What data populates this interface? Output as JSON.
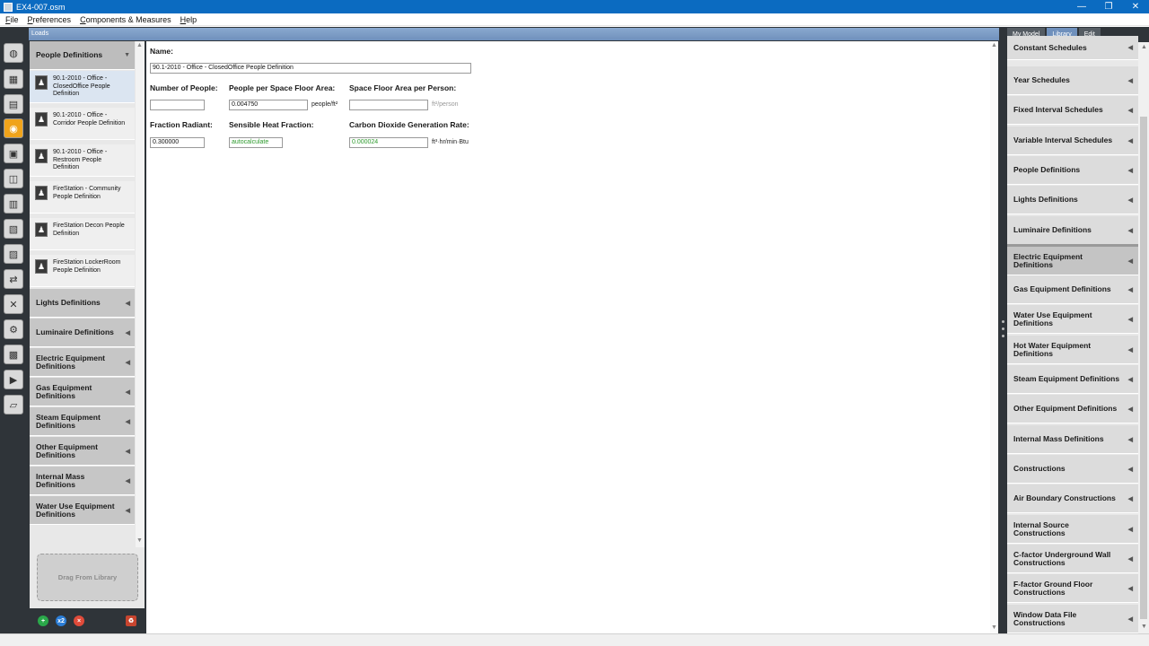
{
  "window": {
    "title": "EX4-007.osm",
    "minimize": "—",
    "maximize": "❐",
    "close": "✕"
  },
  "menu": {
    "items": [
      {
        "first": "F",
        "rest": "ile"
      },
      {
        "first": "P",
        "rest": "references"
      },
      {
        "first": "C",
        "rest": "omponents & Measures"
      },
      {
        "first": "H",
        "rest": "elp"
      }
    ]
  },
  "loads_header": "Loads",
  "left_panel": {
    "open_category": "People Definitions",
    "items": [
      "90.1-2010 - Office - ClosedOffice People Definition",
      "90.1-2010 - Office - Corridor People Definition",
      "90.1-2010 - Office - Restroom People Definition",
      "FireStation - Community People Definition",
      "FireStation Decon People Definition",
      "FireStation LockerRoom People Definition"
    ],
    "categories": [
      "Lights Definitions",
      "Luminaire Definitions",
      "Electric Equipment Definitions",
      "Gas Equipment Definitions",
      "Steam Equipment Definitions",
      "Other Equipment Definitions",
      "Internal Mass Definitions",
      "Water Use Equipment Definitions"
    ],
    "drop_zone": "Drag From Library"
  },
  "form": {
    "name_label": "Name:",
    "name_value": "90.1-2010 - Office - ClosedOffice People Definition",
    "number_people_label": "Number of People:",
    "number_people_value": "",
    "ppl_per_area_label": "People per Space Floor Area:",
    "ppl_per_area_value": "0.004750",
    "ppl_per_area_unit": "people/ft²",
    "area_per_person_label": "Space Floor Area per Person:",
    "area_per_person_value": "",
    "area_per_person_unit": "ft²/person",
    "fraction_radiant_label": "Fraction Radiant:",
    "fraction_radiant_value": "0.300000",
    "sensible_label": "Sensible Heat Fraction:",
    "sensible_value": "autocalculate",
    "co2_label": "Carbon Dioxide Generation Rate:",
    "co2_value": "0.000024",
    "co2_unit": "ft³·hr/min·Btu"
  },
  "right_tabs": [
    "My Model",
    "Library",
    "Edit"
  ],
  "right_panel": {
    "items": [
      "Constant Schedules",
      "Year Schedules",
      "Fixed Interval Schedules",
      "Variable Interval Schedules",
      "People Definitions",
      "Lights Definitions",
      "Luminaire Definitions",
      "Electric Equipment Definitions",
      "Gas Equipment Definitions",
      "Water Use Equipment Definitions",
      "Hot Water Equipment Definitions",
      "Steam Equipment Definitions",
      "Other Equipment Definitions",
      "Internal Mass Definitions",
      "Constructions",
      "Air Boundary Constructions",
      "Internal Source Constructions",
      "C-factor Underground Wall Constructions",
      "F-factor Ground Floor Constructions",
      "Window Data File Constructions"
    ],
    "highlighted": "Electric Equipment Definitions"
  },
  "icons": {
    "expanded_arrow": "▼",
    "collapsed_arrow": "◀",
    "person": "♟",
    "scroll_up": "▲",
    "scroll_down": "▼"
  },
  "colors": {
    "titlebar": "#0b6bc1",
    "active_vertical_tab": "#f0a31b",
    "active_right_tab": "#6f90bc",
    "green_value": "#2d9a2d"
  }
}
